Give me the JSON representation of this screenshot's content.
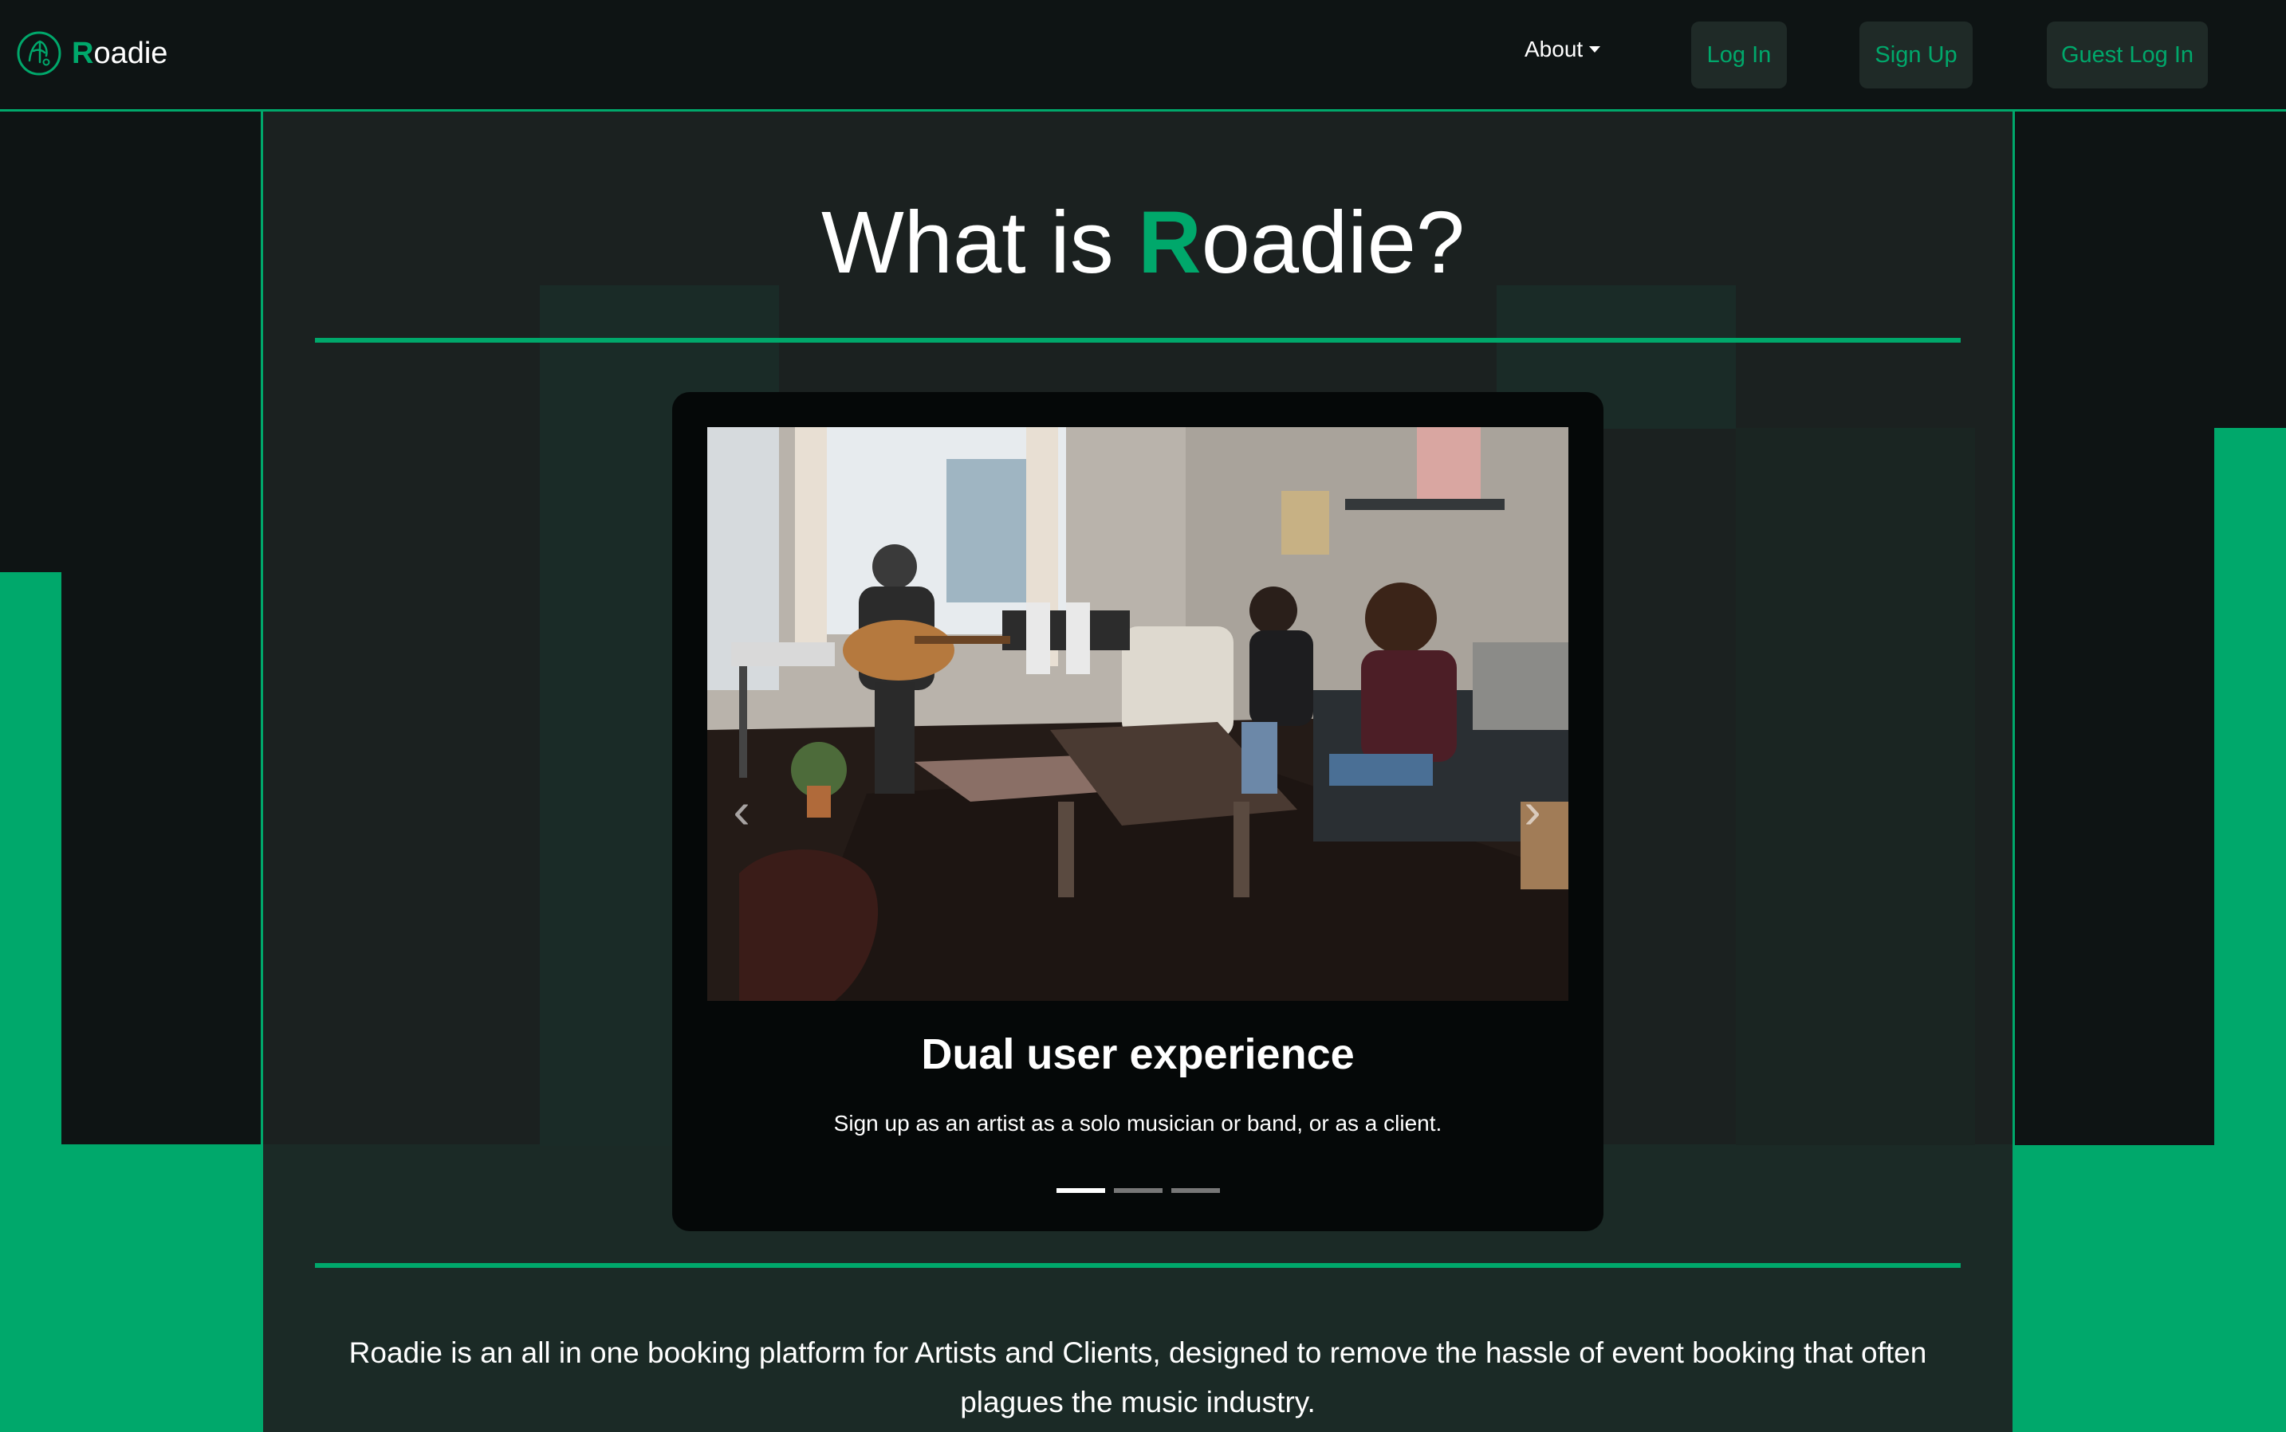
{
  "brand": {
    "initial": "R",
    "rest": "oadie"
  },
  "nav": {
    "about_label": "About",
    "login_label": "Log In",
    "signup_label": "Sign Up",
    "guest_label": "Guest Log In"
  },
  "hero": {
    "title_prefix": "What is ",
    "title_initial": "R",
    "title_rest": "oadie?"
  },
  "carousel": {
    "active_index": 0,
    "slides": [
      {
        "title": "Dual user experience",
        "text": "Sign up as an artist as a solo musician or band, or as a client."
      }
    ],
    "indicator_count": 3
  },
  "description": "Roadie is an all in one booking platform for Artists and Clients, designed to remove the hassle of event booking that often plagues the music industry.",
  "colors": {
    "accent": "#00a86b",
    "background": "#0e1414",
    "panel": "#1b2120"
  }
}
